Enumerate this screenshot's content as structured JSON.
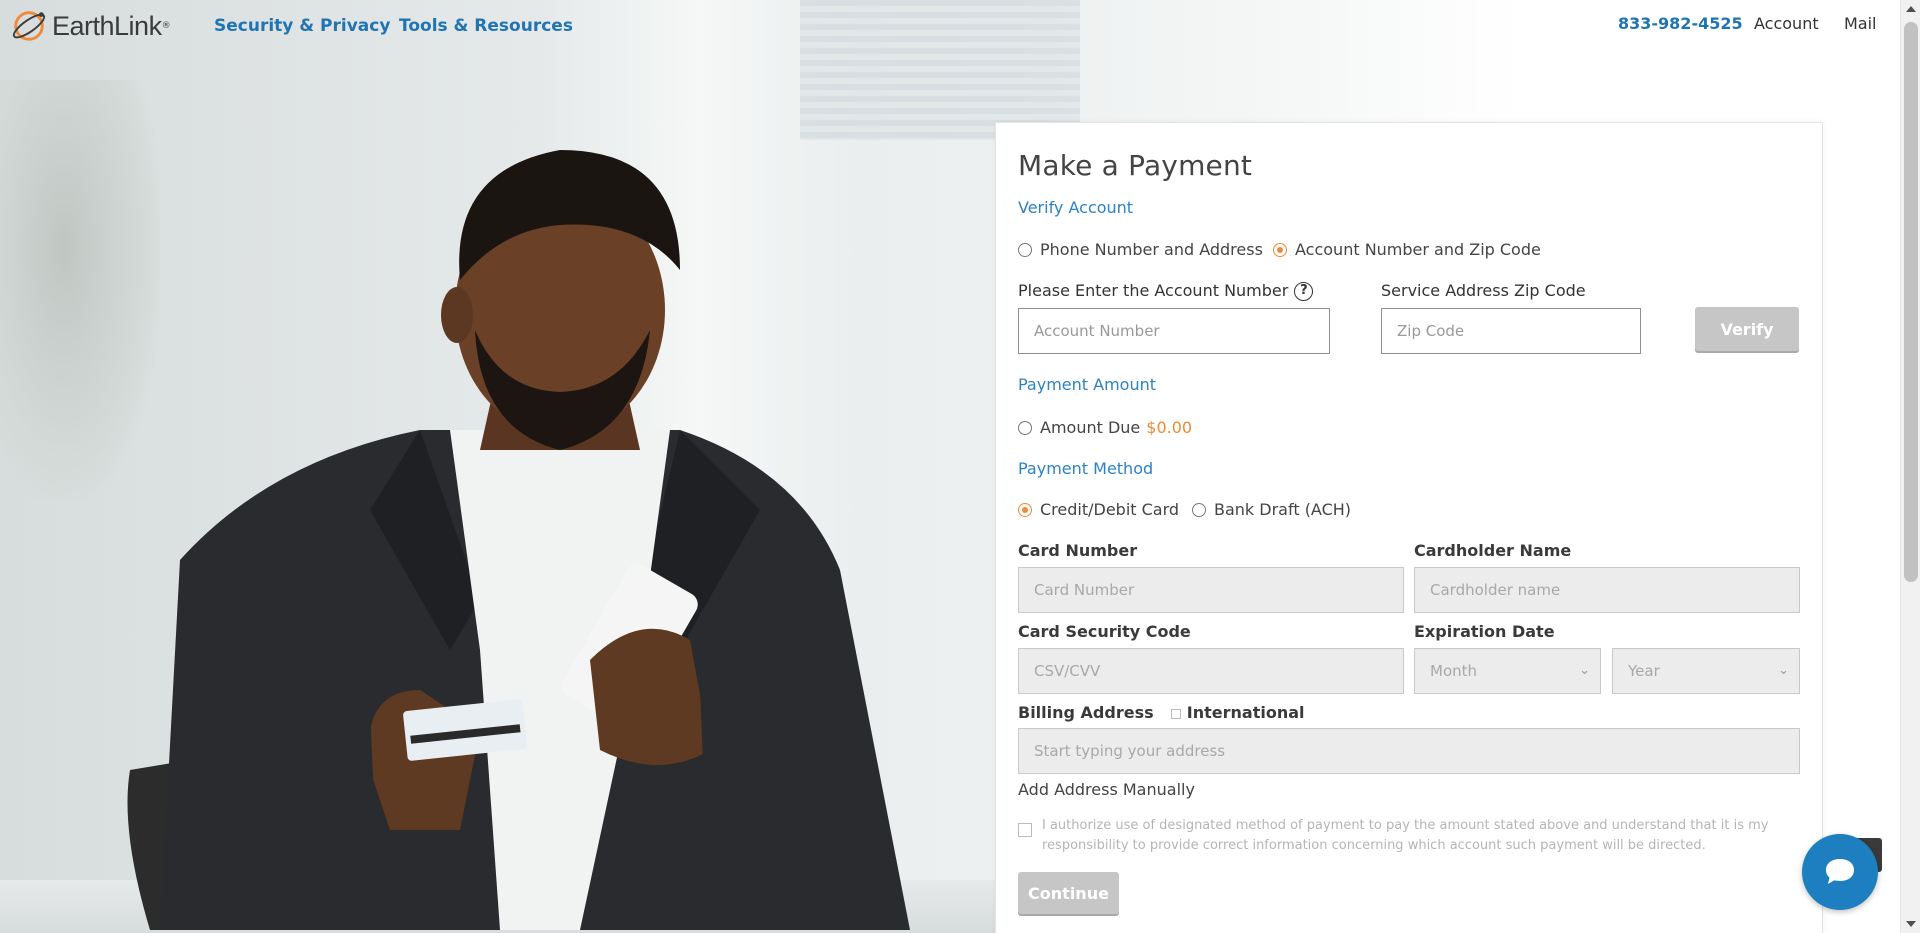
{
  "header": {
    "brand": "EarthLink",
    "nav": [
      "Security & Privacy",
      "Tools & Resources"
    ],
    "phone": "833-982-4525",
    "account": "Account",
    "mail": "Mail"
  },
  "form": {
    "title": "Make a Payment",
    "verify_section": "Verify Account",
    "verify_options": [
      "Phone Number and Address",
      "Account Number and Zip Code"
    ],
    "verify_selected": "Account Number and Zip Code",
    "account_label": "Please Enter the Account Number",
    "account_help": "?",
    "account_placeholder": "Account Number",
    "zip_label": "Service Address Zip Code",
    "zip_placeholder": "Zip Code",
    "verify_button": "Verify",
    "amount_section": "Payment Amount",
    "amount_option": "Amount Due",
    "amount_value": "$0.00",
    "method_section": "Payment Method",
    "method_options": [
      "Credit/Debit Card",
      "Bank Draft (ACH)"
    ],
    "method_selected": "Credit/Debit Card",
    "card_number_label": "Card Number",
    "card_number_placeholder": "Card Number",
    "cardholder_label": "Cardholder Name",
    "cardholder_placeholder": "Cardholder name",
    "security_label": "Card Security Code",
    "security_placeholder": "CSV/CVV",
    "expiration_label": "Expiration Date",
    "month_placeholder": "Month",
    "year_placeholder": "Year",
    "billing_label": "Billing Address",
    "international_label": "International",
    "address_placeholder": "Start typing your address",
    "manual_link": "Add Address Manually",
    "authorize_text": "I authorize use of designated method of payment to pay the amount stated above and understand that it is my responsibility to provide correct information concerning which account such payment will be directed.",
    "continue_button": "Continue"
  },
  "colors": {
    "brand_blue": "#1f74b1",
    "section_blue": "#2d82c4",
    "accent_orange": "#f08a37",
    "disabled_grey": "#c6c6c6"
  },
  "icons": [
    "earthlink-logo-icon",
    "help-icon",
    "chevron-down-icon",
    "chat-icon"
  ]
}
